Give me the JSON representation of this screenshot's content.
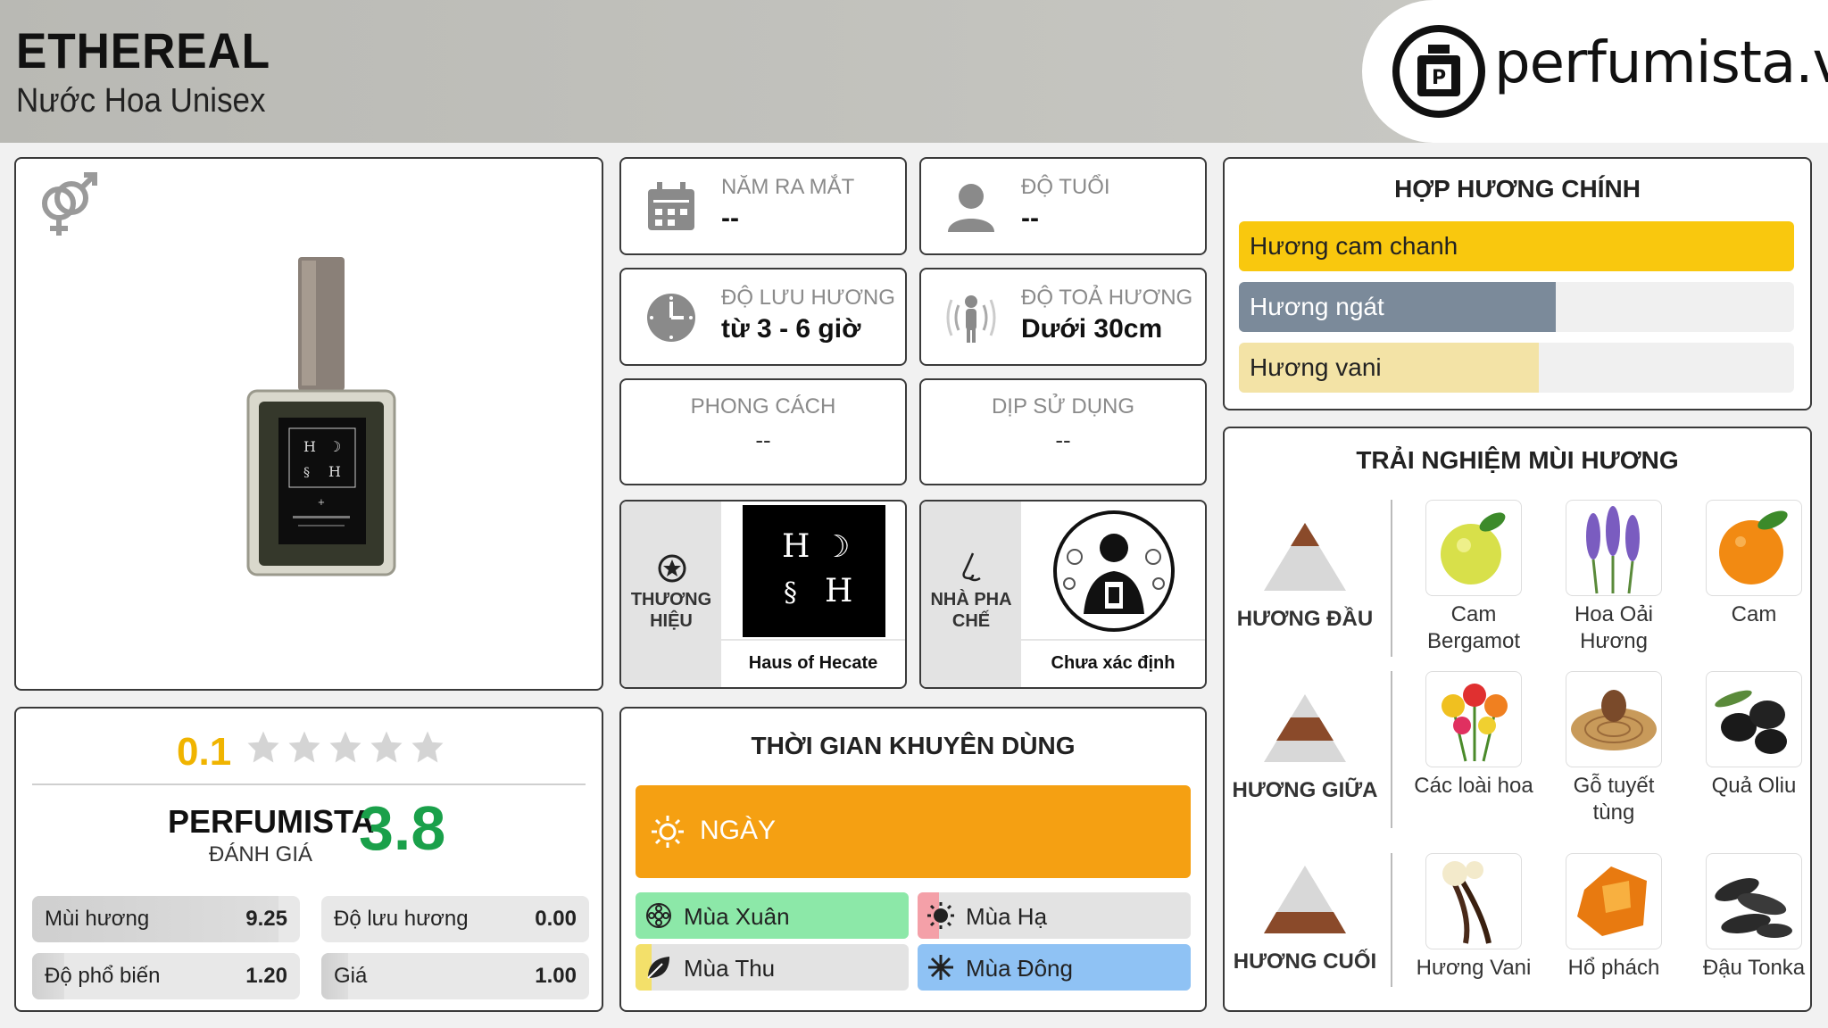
{
  "header": {
    "title": "ETHEREAL",
    "subtitle": "Nước Hoa Unisex",
    "logo_text": "perfumista.vn"
  },
  "info": {
    "release_label": "NĂM RA MẮT",
    "release_value": "--",
    "age_label": "ĐỘ TUỔI",
    "age_value": "--",
    "longevity_label": "ĐỘ LƯU HƯƠNG",
    "longevity_value": "từ 3 - 6 giờ",
    "sillage_label": "ĐỘ TOẢ HƯƠNG",
    "sillage_value": "Dưới 30cm",
    "style_label": "PHONG CÁCH",
    "style_value": "--",
    "occasion_label": "DỊP SỬ DỤNG",
    "occasion_value": "--"
  },
  "brand": {
    "label_line1": "THƯƠNG",
    "label_line2": "HIỆU",
    "name": "Haus of Hecate"
  },
  "perfumer": {
    "label_line1": "NHÀ PHA",
    "label_line2": "CHẾ",
    "name": "Chưa xác định"
  },
  "accords": {
    "title": "HỢP HƯƠNG CHÍNH",
    "items": [
      {
        "label": "Hương cam chanh",
        "percent": 100,
        "color": "#f9c80e"
      },
      {
        "label": "Hương ngát",
        "percent": 57,
        "color": "#7b8a9a"
      },
      {
        "label": "Hương vani",
        "percent": 54,
        "color": "#f3e3a6"
      }
    ]
  },
  "notes": {
    "title": "TRẢI NGHIỆM MÙI HƯƠNG",
    "top_label": "HƯƠNG ĐẦU",
    "middle_label": "HƯƠNG GIỮA",
    "base_label": "HƯƠNG CUỐI",
    "top": [
      {
        "line1": "Cam",
        "line2": "Bergamot"
      },
      {
        "line1": "Hoa Oải",
        "line2": "Hương"
      },
      {
        "line1": "Cam",
        "line2": ""
      }
    ],
    "middle": [
      {
        "line1": "Các loài hoa",
        "line2": ""
      },
      {
        "line1": "Gỗ tuyết",
        "line2": "tùng"
      },
      {
        "line1": "Quả Oliu",
        "line2": ""
      }
    ],
    "base": [
      {
        "line1": "Hương Vani",
        "line2": ""
      },
      {
        "line1": "Hổ phách",
        "line2": ""
      },
      {
        "line1": "Đậu Tonka",
        "line2": ""
      }
    ]
  },
  "rating": {
    "user_score": "0.1",
    "stars_filled": 0,
    "stars_total": 5,
    "perfumista_label": "PERFUMISTA",
    "perfumista_sub": "ĐÁNH GIÁ",
    "perfumista_score": "3.8",
    "stats": [
      {
        "label": "Mùi hương",
        "value": "9.25",
        "fraction": 0.92
      },
      {
        "label": "Độ lưu hương",
        "value": "0.00",
        "fraction": 0.0
      },
      {
        "label": "Độ phổ biến",
        "value": "1.20",
        "fraction": 0.12
      },
      {
        "label": "Giá",
        "value": "1.00",
        "fraction": 0.1
      }
    ]
  },
  "timing": {
    "title": "THỜI GIAN KHUYÊN DÙNG",
    "day_label": "NGÀY",
    "seasons": [
      {
        "label": "Mùa Xuân",
        "fraction": 1.0,
        "color": "#8ce8a8"
      },
      {
        "label": "Mùa Hạ",
        "fraction": 0.08,
        "color": "#f4a0a8"
      },
      {
        "label": "Mùa Thu",
        "fraction": 0.06,
        "color": "#f3e06a"
      },
      {
        "label": "Mùa Đông",
        "fraction": 1.0,
        "color": "#8fc2f4"
      }
    ]
  },
  "colors": {
    "accent_orange": "#f5a012",
    "score_green": "#1aa04a",
    "score_yellow": "#f0b400"
  }
}
